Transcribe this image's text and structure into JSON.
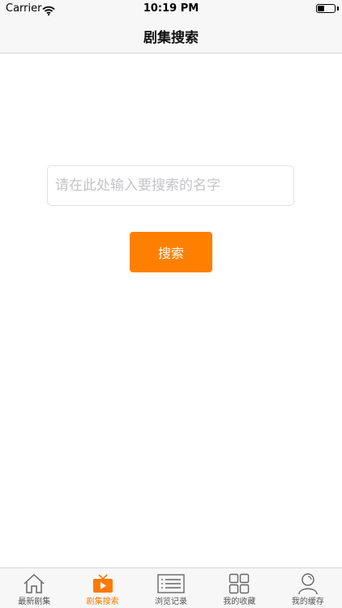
{
  "status_bar": {
    "carrier": "Carrier",
    "time": "10:19 PM"
  },
  "nav": {
    "title": "剧集搜索"
  },
  "search": {
    "placeholder": "请在此处输入要搜索的名字",
    "value": "",
    "button_label": "搜索"
  },
  "tabs": [
    {
      "label": "最新剧集",
      "icon": "home-icon",
      "active": false
    },
    {
      "label": "剧集搜索",
      "icon": "tv-play-icon",
      "active": true
    },
    {
      "label": "浏览记录",
      "icon": "list-icon",
      "active": false
    },
    {
      "label": "我的收藏",
      "icon": "grid-icon",
      "active": false
    },
    {
      "label": "我的缓存",
      "icon": "person-icon",
      "active": false
    }
  ],
  "colors": {
    "accent": "#ff8000",
    "inactive": "#555555",
    "bar_background": "#f7f7f7"
  }
}
